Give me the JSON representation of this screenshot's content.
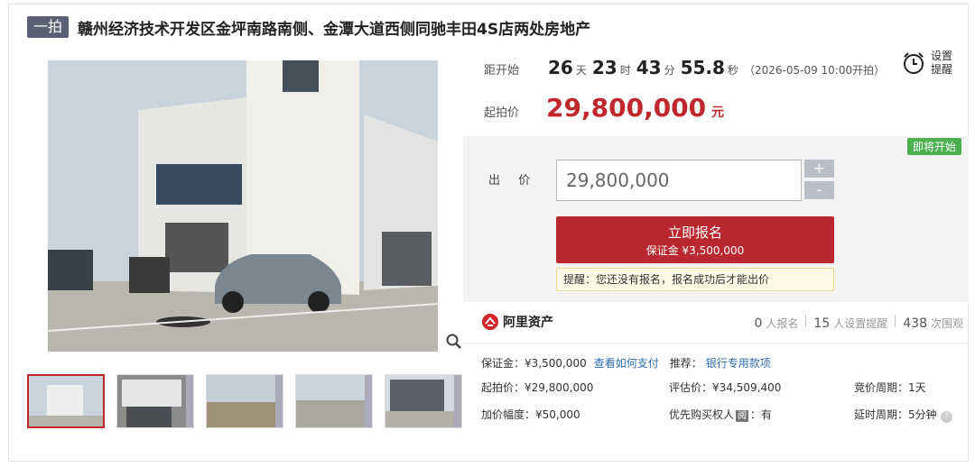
{
  "header": {
    "tag": "一拍",
    "title": "赣州经济技术开发区金坪南路南侧、金潭大道西侧同驰丰田4S店两处房地产"
  },
  "countdown": {
    "label": "距开始",
    "days": "26",
    "days_unit": "天",
    "hours": "23",
    "hours_unit": "时",
    "minutes": "43",
    "minutes_unit": "分",
    "seconds": "55.8",
    "seconds_unit": "秒",
    "start": "（2026-05-09 10:00开拍）"
  },
  "remind": {
    "label": "设置提醒"
  },
  "start_price": {
    "label": "起拍价",
    "value": "29,800,000",
    "unit": "元"
  },
  "bid": {
    "badge": "即将开始",
    "label": "出 价",
    "value": "29,800,000",
    "plus": "+",
    "minus": "-",
    "signup": "立即报名",
    "deposit": "保证金 ¥3,500,000",
    "notice": "提醒：您还没有报名，报名成功后才能出价"
  },
  "stats": {
    "brand": "阿里资产",
    "apply_count": "0",
    "apply_label": "人报名",
    "remind_count": "15",
    "remind_label": "人设置提醒",
    "view_count": "438",
    "view_label": "次围观"
  },
  "info": {
    "deposit": "保证金：¥3,500,000",
    "how_pay": "查看如何支付",
    "recommend_label": "推荐：",
    "recommend": "银行专用款项",
    "start": "起拍价：¥29,800,000",
    "eval": "评估价：¥34,509,400",
    "cycle": "竞价周期：1天",
    "step": "加价幅度：¥50,000",
    "priority_label": "优先购买权人",
    "priority_tag": "阅",
    "priority_value": "：有",
    "delay": "延时周期：5分钟",
    "help": "?"
  },
  "colors": {
    "accent": "#c0272d",
    "badge_green": "#4caf50",
    "link": "#2b6cb0"
  }
}
